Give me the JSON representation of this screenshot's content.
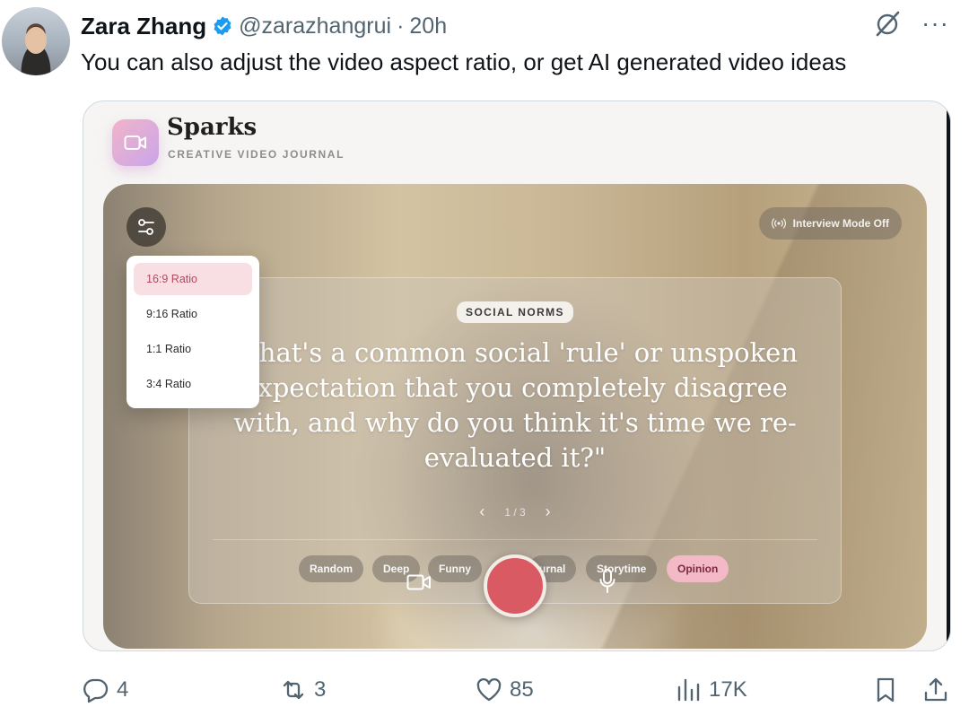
{
  "tweet": {
    "author_name": "Zara Zhang",
    "handle": "@zarazhangrui",
    "separator": "·",
    "time": "20h",
    "text": "You can also adjust the video aspect ratio, or get AI generated video ideas",
    "more_label": "···"
  },
  "app": {
    "title": "Sparks",
    "subtitle": "CREATIVE VIDEO JOURNAL",
    "interview_mode_label": "Interview Mode Off",
    "ratio_options": [
      {
        "label": "16:9 Ratio",
        "selected": true
      },
      {
        "label": "9:16 Ratio",
        "selected": false
      },
      {
        "label": "1:1 Ratio",
        "selected": false
      },
      {
        "label": "3:4 Ratio",
        "selected": false
      }
    ],
    "prompt": {
      "category": "SOCIAL NORMS",
      "question": "What's a common social 'rule' or unspoken expectation that you completely disagree with, and why do you think it's time we re-evaluated it?\"",
      "pager_prev": "‹",
      "pager_text": "1 / 3",
      "pager_next": "›"
    },
    "chips": [
      {
        "label": "Random",
        "active": false
      },
      {
        "label": "Deep",
        "active": false
      },
      {
        "label": "Funny",
        "active": false
      },
      {
        "label": "urnal",
        "active": false
      },
      {
        "label": "Storytime",
        "active": false
      },
      {
        "label": "Opinion",
        "active": true
      }
    ],
    "colors": {
      "record": "#d95a62",
      "accent_pink": "#f3b9c6",
      "icon_gradient_start": "#f2b3c9",
      "icon_gradient_end": "#c9a6e9"
    }
  },
  "actions": {
    "replies": "4",
    "reposts": "3",
    "likes": "85",
    "views": "17K"
  },
  "icons": [
    "verified-badge-icon",
    "grok-icon",
    "more-icon",
    "video-camera-icon",
    "settings-sliders-icon",
    "broadcast-icon",
    "microphone-icon",
    "reply-icon",
    "repost-icon",
    "like-icon",
    "views-icon",
    "bookmark-icon",
    "share-icon"
  ],
  "colors": {
    "text": "#0f1419",
    "muted": "#536471",
    "verified": "#1d9bf0"
  }
}
